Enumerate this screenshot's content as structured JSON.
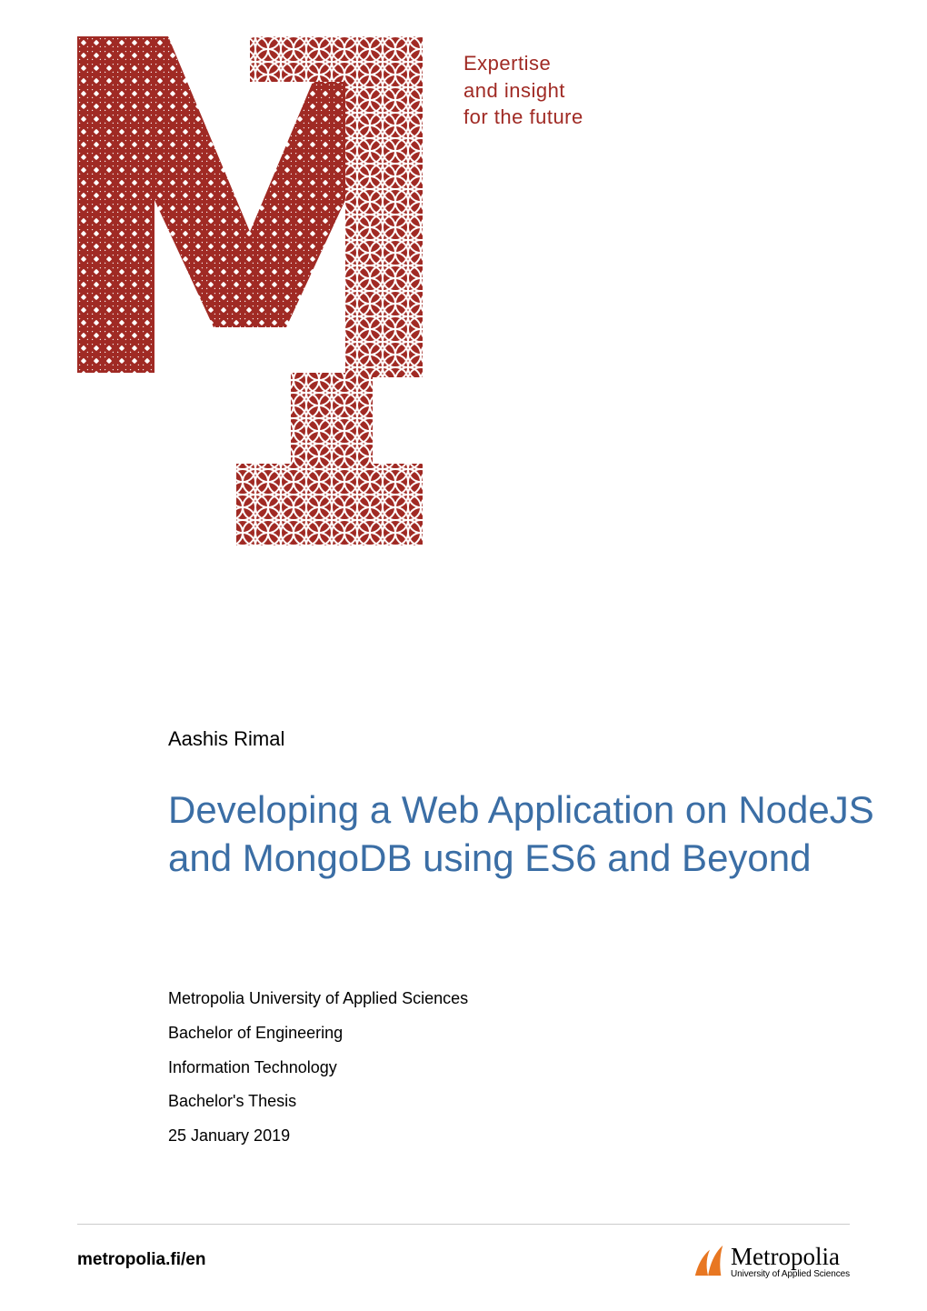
{
  "tagline": {
    "line1": "Expertise",
    "line2": "and insight",
    "line3": "for the future"
  },
  "author": "Aashis Rimal",
  "title": "Developing a Web Application on NodeJS and MongoDB using ES6 and Beyond",
  "meta": {
    "institution": "Metropolia University of Applied Sciences",
    "degree": "Bachelor of Engineering",
    "program": "Information Technology",
    "type": "Bachelor's Thesis",
    "date": "25 January 2019"
  },
  "footer": {
    "url": "metropolia.fi/en",
    "logo_name": "Metropolia",
    "logo_sub": "University of Applied Sciences"
  },
  "colors": {
    "brand_red": "#a02a24",
    "title_blue": "#3b6ea5",
    "logo_orange": "#e87722"
  }
}
